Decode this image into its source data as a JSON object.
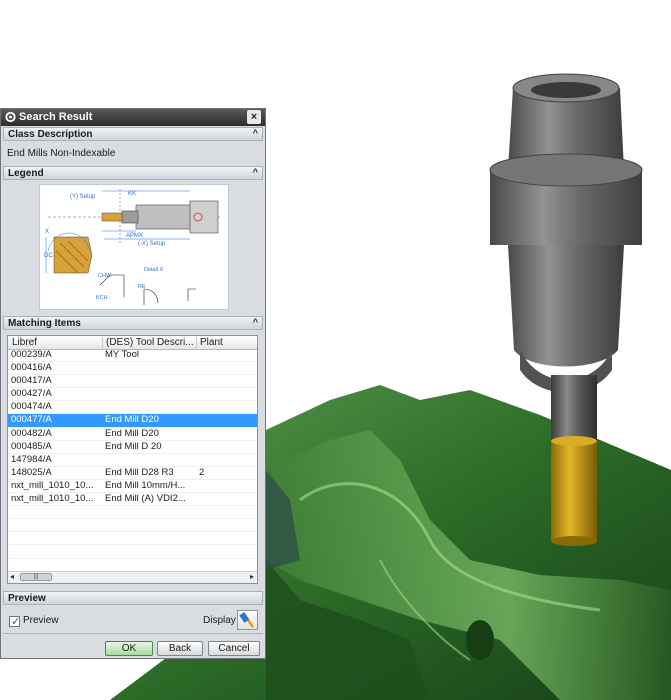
{
  "dialog": {
    "title": "Search Result",
    "close_glyph": "×",
    "sections": {
      "class_description": "Class Description",
      "legend": "Legend",
      "matching_items": "Matching Items",
      "preview": "Preview"
    },
    "collapse_glyph": "^",
    "class_description_value": "End Mills Non-Indexable",
    "legend_labels": {
      "y_setup": "(Y) Setup",
      "kk": "KK",
      "apmx": "APMX",
      "x_setup": "(-X) Setup",
      "x": "X",
      "dc": "DC",
      "chw": "CHW",
      "re": "RE",
      "kch": "KCH",
      "detail_x": "Detail  X"
    },
    "table": {
      "columns": [
        "Libref",
        "(DES) Tool Descri...",
        "Plant"
      ],
      "rows": [
        {
          "libref": "000239/A",
          "desc": "MY Tool",
          "plant": ""
        },
        {
          "libref": "000416/A",
          "desc": "",
          "plant": ""
        },
        {
          "libref": "000417/A",
          "desc": "",
          "plant": ""
        },
        {
          "libref": "000427/A",
          "desc": "",
          "plant": ""
        },
        {
          "libref": "000474/A",
          "desc": "",
          "plant": ""
        },
        {
          "libref": "000477/A",
          "desc": "End Mill D20",
          "plant": ""
        },
        {
          "libref": "000482/A",
          "desc": "End Mill D20",
          "plant": ""
        },
        {
          "libref": "000485/A",
          "desc": "End Mill D 20",
          "plant": ""
        },
        {
          "libref": "147984/A",
          "desc": "",
          "plant": ""
        },
        {
          "libref": "148025/A",
          "desc": "End Mill D28 R3",
          "plant": "2"
        },
        {
          "libref": "nxt_mill_1010_10...",
          "desc": "End Mill 10mm/H...",
          "plant": ""
        },
        {
          "libref": "nxt_mill_1010_10...",
          "desc": "End Mill (A) VDI2...",
          "plant": ""
        },
        {
          "libref": "",
          "desc": "",
          "plant": ""
        },
        {
          "libref": "",
          "desc": "",
          "plant": ""
        },
        {
          "libref": "",
          "desc": "",
          "plant": ""
        },
        {
          "libref": "",
          "desc": "",
          "plant": ""
        },
        {
          "libref": "",
          "desc": "",
          "plant": ""
        },
        {
          "libref": "",
          "desc": "",
          "plant": ""
        }
      ],
      "selected_row": 5,
      "scroll_left": "◂",
      "scroll_right": "▸",
      "scroll_grip": "|||"
    },
    "preview_label": "Preview",
    "preview_checked": true,
    "checkmark": "✓",
    "display_label": "Display",
    "buttons": {
      "ok": "OK",
      "back": "Back",
      "cancel": "Cancel"
    }
  },
  "icons": {
    "gear": "gear-icon",
    "close": "close-icon",
    "display": "display-tool-icon"
  },
  "colors": {
    "selection": "#3399ff",
    "titlebar": "#3a3a3a",
    "part_green": "#2f6a2b",
    "tool_cutter": "#c9a018",
    "holder_gray": "#6e6e6e"
  }
}
